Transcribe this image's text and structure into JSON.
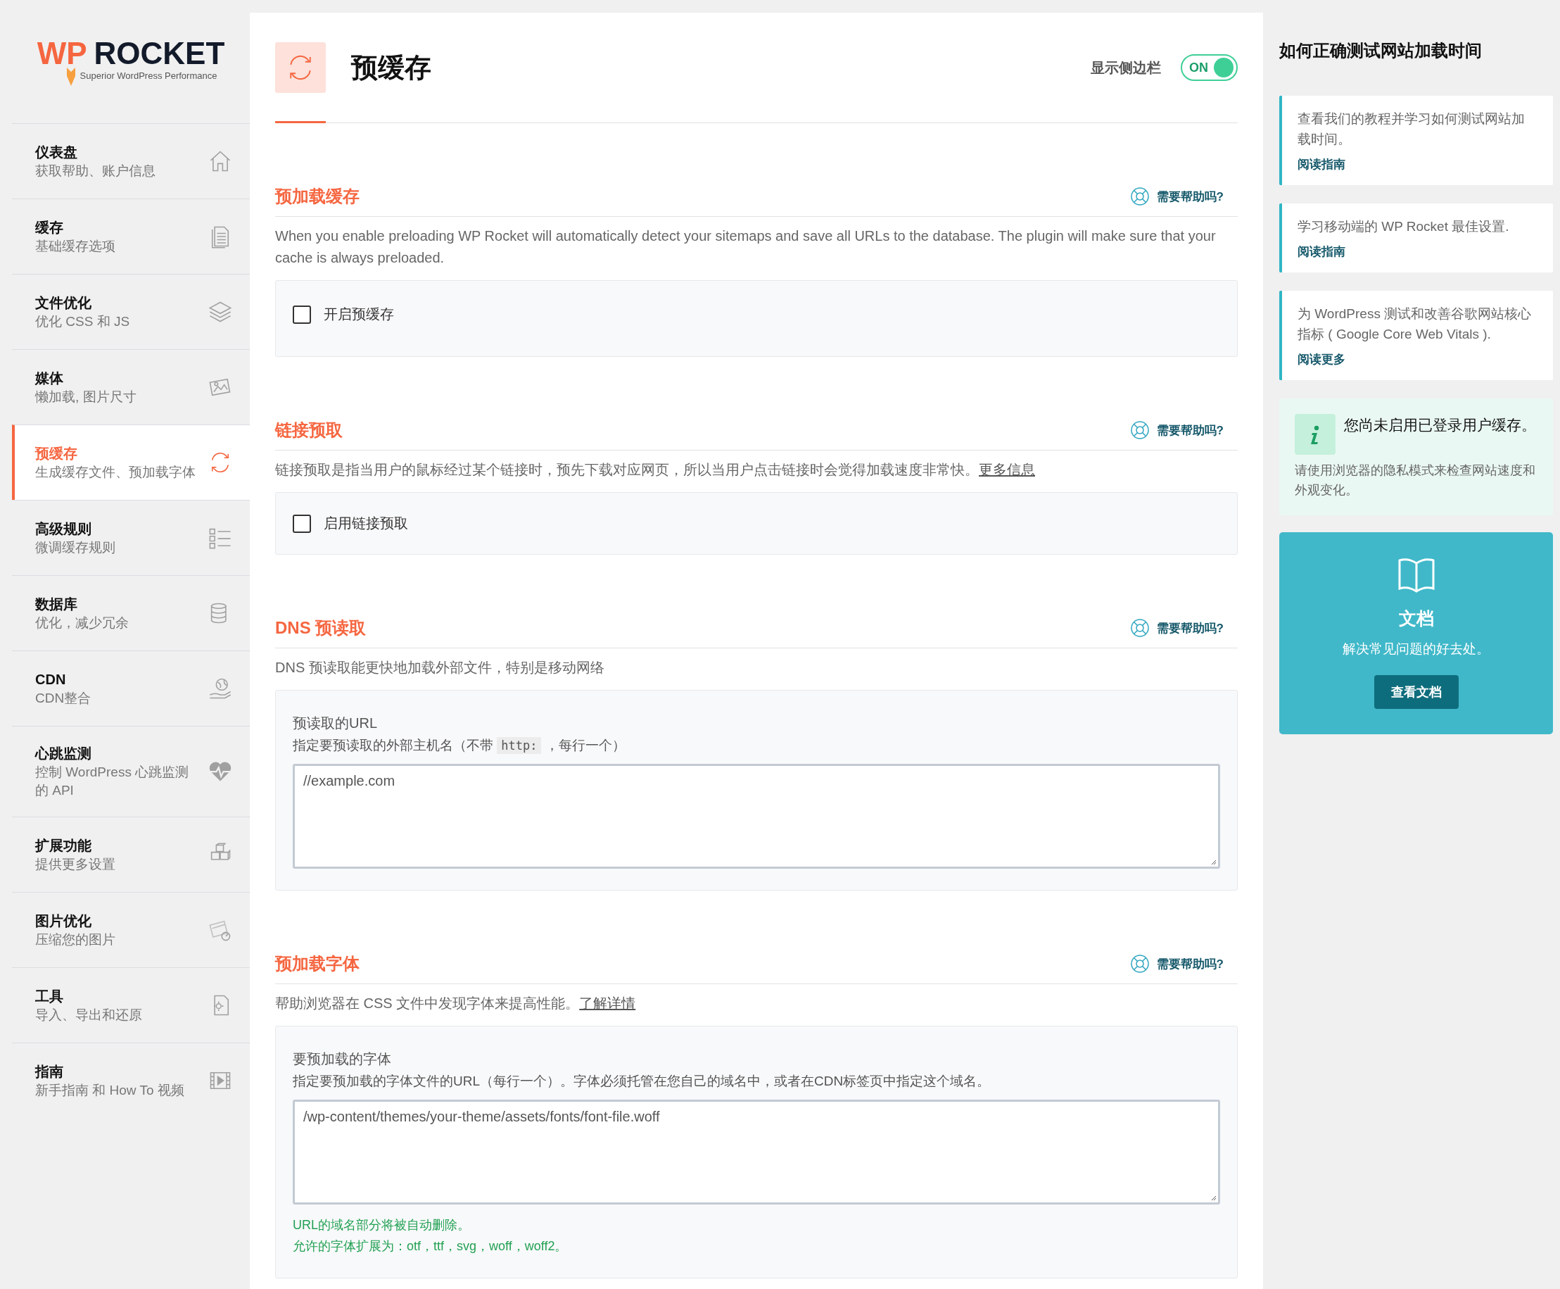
{
  "sidebar": {
    "logo": {
      "wp": "WP",
      "rocket": "ROCKET",
      "tagline": "Superior WordPress Performance"
    },
    "items": [
      {
        "title": "仪表盘",
        "subtitle": "获取帮助、账户信息",
        "selected": false
      },
      {
        "title": "缓存",
        "subtitle": "基础缓存选项",
        "selected": false
      },
      {
        "title": "文件优化",
        "subtitle": "优化 CSS 和 JS",
        "selected": false
      },
      {
        "title": "媒体",
        "subtitle": "懒加载, 图片尺寸",
        "selected": false
      },
      {
        "title": "预缓存",
        "subtitle": "生成缓存文件、预加载字体",
        "selected": true
      },
      {
        "title": "高级规则",
        "subtitle": "微调缓存规则",
        "selected": false
      },
      {
        "title": "数据库",
        "subtitle": "优化，减少冗余",
        "selected": false
      },
      {
        "title": "CDN",
        "subtitle": "CDN整合",
        "selected": false
      },
      {
        "title": "心跳监测",
        "subtitle": "控制 WordPress 心跳监测的 API",
        "selected": false
      },
      {
        "title": "扩展功能",
        "subtitle": "提供更多设置",
        "selected": false
      },
      {
        "title": "图片优化",
        "subtitle": "压缩您的图片",
        "selected": false
      },
      {
        "title": "工具",
        "subtitle": "导入、导出和还原",
        "selected": false
      },
      {
        "title": "指南",
        "subtitle": "新手指南 和 How To 视频",
        "selected": false
      }
    ]
  },
  "header": {
    "title": "预缓存",
    "sidebar_toggle": {
      "label": "显示侧边栏",
      "state_label": "ON",
      "on": true
    }
  },
  "sections": [
    {
      "title": "预加载缓存",
      "help": "需要帮助吗?",
      "description": "When you enable preloading WP Rocket will automatically detect your sitemaps and save all URLs to the database. The plugin will make sure that your cache is always preloaded.",
      "field": {
        "kind": "checkbox",
        "label": "开启预缓存",
        "checked": false
      }
    },
    {
      "title": "链接预取",
      "help": "需要帮助吗?",
      "description": "链接预取是指当用户的鼠标经过某个链接时，预先下载对应网页，所以当用户点击链接时会觉得加载速度非常快。",
      "link": "更多信息",
      "field": {
        "kind": "checkbox",
        "label": "启用链接预取",
        "checked": false
      }
    },
    {
      "title": "DNS 预读取",
      "help": "需要帮助吗?",
      "description": "DNS 预读取能更快地加载外部文件，特别是移动网络",
      "field": {
        "kind": "textarea",
        "label": "预读取的URL",
        "hint_before": "指定要预读取的外部主机名（不带",
        "hint_code": "http:",
        "hint_after": "，每行一个）",
        "value": "//example.com"
      }
    },
    {
      "title": "预加载字体",
      "help": "需要帮助吗?",
      "description": "帮助浏览器在 CSS 文件中发现字体来提高性能。",
      "link": "了解详情",
      "field": {
        "kind": "textarea",
        "label": "要预加载的字体",
        "hint_before": "指定要预加载的字体文件的URL（每行一个）。字体必须托管在您自己的域名中，或者在CDN标签页中指定这个域名。",
        "value": "/wp-content/themes/your-theme/assets/fonts/font-file.woff",
        "notes": [
          "URL的域名部分将被自动删除。",
          "允许的字体扩展为：otf，ttf，svg，woff，woff2。"
        ]
      }
    }
  ],
  "right_panel": {
    "heading": "如何正确测试网站加载时间",
    "cards": [
      {
        "text": "查看我们的教程并学习如何测试网站加载时间。",
        "link": "阅读指南"
      },
      {
        "text": "学习移动端的 WP Rocket 最佳设置.",
        "link": "阅读指南"
      },
      {
        "text": "为 WordPress 测试和改善谷歌网站核心指标 ( Google Core Web Vitals ).",
        "link": "阅读更多"
      }
    ],
    "notice": {
      "title": "您尚未启用已登录用户缓存。",
      "text": "请使用浏览器的隐私模式来检查网站速度和外观变化。"
    },
    "docs": {
      "title": "文档",
      "text": "解决常见问题的好去处。",
      "button": "查看文档"
    }
  }
}
